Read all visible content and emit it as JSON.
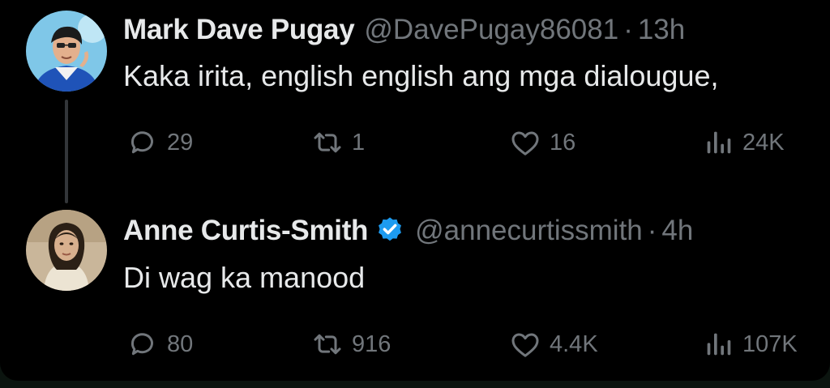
{
  "tweets": [
    {
      "author_name": "Mark Dave Pugay",
      "handle": "@DavePugay86081",
      "separator": "·",
      "time": "13h",
      "text": "Kaka irita, english english ang mga dialougue,",
      "verified": false,
      "stats": {
        "replies": "29",
        "retweets": "1",
        "likes": "16",
        "views": "24K"
      }
    },
    {
      "author_name": "Anne Curtis-Smith",
      "handle": "@annecurtissmith",
      "separator": "·",
      "time": "4h",
      "text": "Di wag ka manood",
      "verified": true,
      "stats": {
        "replies": "80",
        "retweets": "916",
        "likes": "4.4K",
        "views": "107K"
      }
    }
  ],
  "icons": {
    "reply": "reply-icon",
    "retweet": "retweet-icon",
    "like": "heart-icon",
    "views": "views-chart-icon",
    "verified": "verified-badge-icon"
  },
  "colors": {
    "background": "#000000",
    "primary_text": "#e7e9ea",
    "secondary_text": "#71767b",
    "verified_blue": "#1d9bf0",
    "thread_line": "#333639"
  }
}
